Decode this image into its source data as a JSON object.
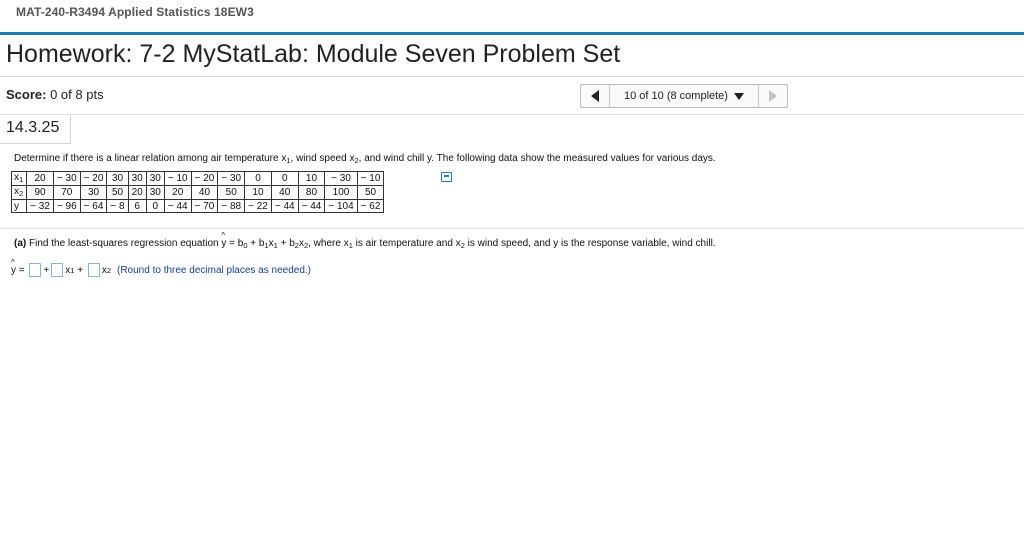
{
  "course": {
    "title": "MAT-240-R3494 Applied Statistics 18EW3"
  },
  "homework": {
    "title": "Homework: 7-2 MyStatLab: Module Seven Problem Set"
  },
  "score": {
    "label": "Score:",
    "value": "0 of 8 pts"
  },
  "navigator": {
    "status": "10 of 10 (8 complete)"
  },
  "problem": {
    "id": "14.3.25",
    "prompt_pre": "Determine if there is a linear relation among air temperature x",
    "prompt_sub1": "1",
    "prompt_mid": ", wind speed x",
    "prompt_sub2": "2",
    "prompt_post": ", and wind chill y. The following data show the measured values for various days."
  },
  "table": {
    "rows": [
      {
        "label": "x",
        "sub": "1",
        "values": [
          "20",
          "− 30",
          "− 20",
          "30",
          "30",
          "30",
          "− 10",
          "− 20",
          "− 30",
          "0",
          "0",
          "10",
          "− 30",
          "− 10"
        ]
      },
      {
        "label": "x",
        "sub": "2",
        "values": [
          "90",
          "70",
          "30",
          "50",
          "20",
          "30",
          "20",
          "40",
          "50",
          "10",
          "40",
          "80",
          "100",
          "50"
        ]
      },
      {
        "label": "y",
        "sub": "",
        "values": [
          "− 32",
          "− 96",
          "− 64",
          "− 8",
          "6",
          "0",
          "− 44",
          "− 70",
          "− 88",
          "− 22",
          "− 44",
          "− 44",
          "− 104",
          "− 62"
        ]
      }
    ]
  },
  "part_a": {
    "lead": "(a)",
    "text1": " Find the least-squares regression equation ",
    "eq_y": "y",
    "eq_mid1": " = b",
    "eq_s0": "0",
    "eq_mid2": " + b",
    "eq_s1": "1",
    "eq_mid3": "x",
    "eq_s1b": "1",
    "eq_mid4": " + b",
    "eq_s2": "2",
    "eq_mid5": "x",
    "eq_s2b": "2",
    "text2": ", where x",
    "t_s1": "1",
    "text3": " is air temperature and x",
    "t_s2": "2",
    "text4": " is wind speed, and y is the response variable, wind chill."
  },
  "answer": {
    "y": "y",
    "eq": " = ",
    "plus1": "+",
    "x1": "x",
    "x1_sub": "1",
    "plus2": " + ",
    "x2": "x",
    "x2_sub": "2",
    "note": "(Round to three decimal places as needed.)"
  }
}
